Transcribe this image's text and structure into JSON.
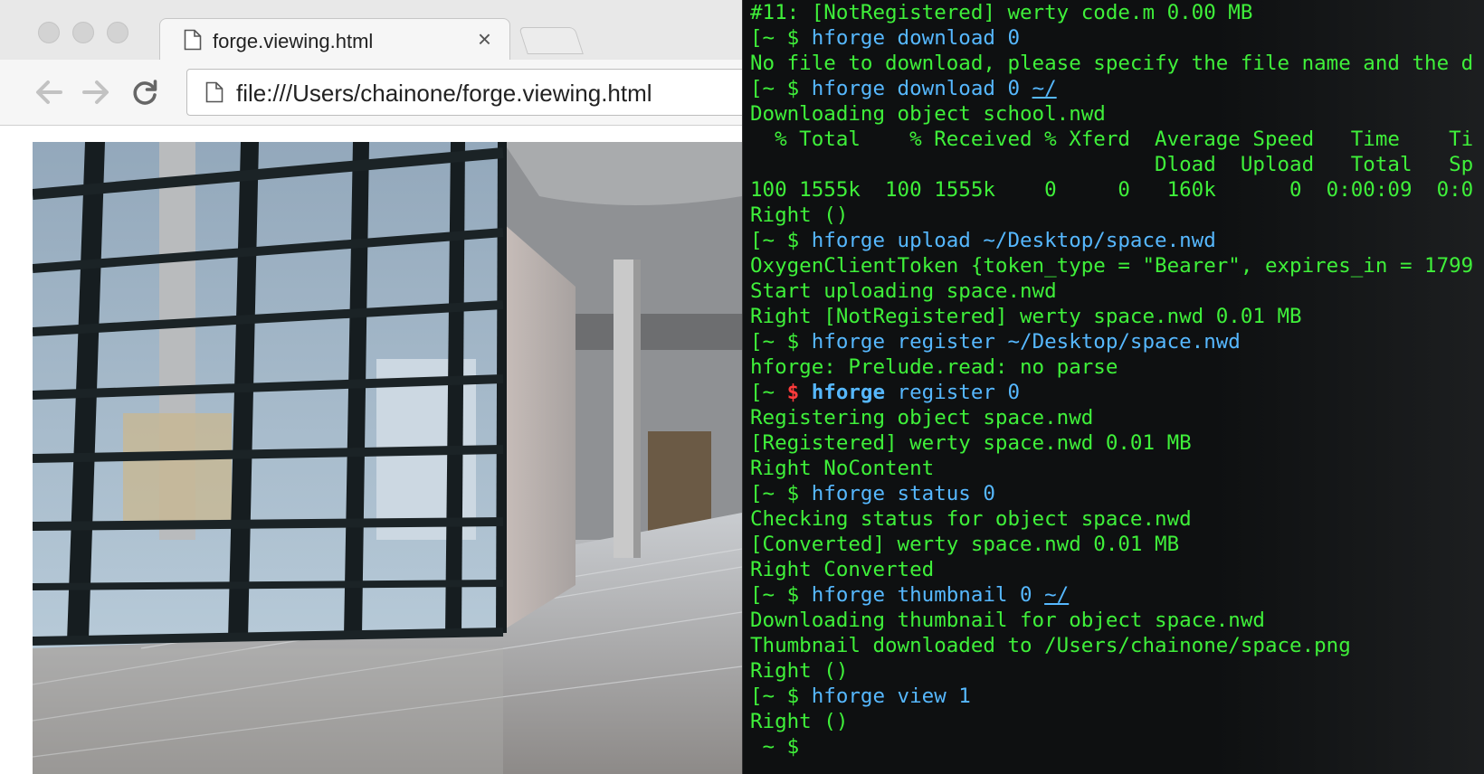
{
  "browser": {
    "tab_title": "forge.viewing.html",
    "tab_close": "×",
    "url": "file:///Users/chainone/forge.viewing.html",
    "icons": [
      "back-icon",
      "forward-icon",
      "reload-icon",
      "document-icon"
    ]
  },
  "terminal": {
    "lines": [
      {
        "type": "out",
        "text": "#11: [NotRegistered] werty code.m 0.00 MB"
      },
      {
        "type": "cmd",
        "prompt": "[~ $ ",
        "command": "hforge download 0"
      },
      {
        "type": "out",
        "text": "No file to download, please specify the file name and the d"
      },
      {
        "type": "cmd",
        "prompt": "[~ $ ",
        "command": "hforge download 0 ",
        "arg": "~/"
      },
      {
        "type": "out",
        "text": "Downloading object school.nwd"
      },
      {
        "type": "out",
        "text": "  % Total    % Received % Xferd  Average Speed   Time    Ti"
      },
      {
        "type": "out",
        "text": "                                 Dload  Upload   Total   Sp"
      },
      {
        "type": "out",
        "text": "100 1555k  100 1555k    0     0   160k      0  0:00:09  0:0"
      },
      {
        "type": "out",
        "text": "Right ()"
      },
      {
        "type": "cmd",
        "prompt": "[~ $ ",
        "command": "hforge upload ~/Desktop/space.nwd"
      },
      {
        "type": "out",
        "text": "OxygenClientToken {token_type = \"Bearer\", expires_in = 1799"
      },
      {
        "type": "out",
        "text": "Start uploading space.nwd"
      },
      {
        "type": "out",
        "text": "Right [NotRegistered] werty space.nwd 0.01 MB"
      },
      {
        "type": "cmd",
        "prompt": "[~ $ ",
        "command": "hforge register ~/Desktop/space.nwd"
      },
      {
        "type": "out",
        "text": "hforge: Prelude.read: no parse"
      },
      {
        "type": "cmd_bold",
        "prompt": "[~ ",
        "dollar": "$ ",
        "command_bold": "hforge",
        "command": " register 0"
      },
      {
        "type": "out",
        "text": "Registering object space.nwd"
      },
      {
        "type": "out",
        "text": "[Registered] werty space.nwd 0.01 MB"
      },
      {
        "type": "out",
        "text": "Right NoContent"
      },
      {
        "type": "cmd",
        "prompt": "[~ $ ",
        "command": "hforge status 0"
      },
      {
        "type": "out",
        "text": "Checking status for object space.nwd"
      },
      {
        "type": "out",
        "text": "[Converted] werty space.nwd 0.01 MB"
      },
      {
        "type": "out",
        "text": "Right Converted"
      },
      {
        "type": "cmd",
        "prompt": "[~ $ ",
        "command": "hforge thumbnail 0 ",
        "arg": "~/"
      },
      {
        "type": "out",
        "text": "Downloading thumbnail for object space.nwd"
      },
      {
        "type": "out",
        "text": "Thumbnail downloaded to /Users/chainone/space.png"
      },
      {
        "type": "out",
        "text": "Right ()"
      },
      {
        "type": "cmd",
        "prompt": "[~ $ ",
        "command": "hforge view 1"
      },
      {
        "type": "out",
        "text": "Right ()"
      },
      {
        "type": "cmd",
        "prompt": " ~ $ ",
        "command": ""
      }
    ]
  },
  "colors": {
    "terminal_bg": "#0e1011",
    "terminal_text": "#3ff03a",
    "terminal_command": "#56b8ff",
    "terminal_prompt_alert": "#ff3b3b"
  }
}
